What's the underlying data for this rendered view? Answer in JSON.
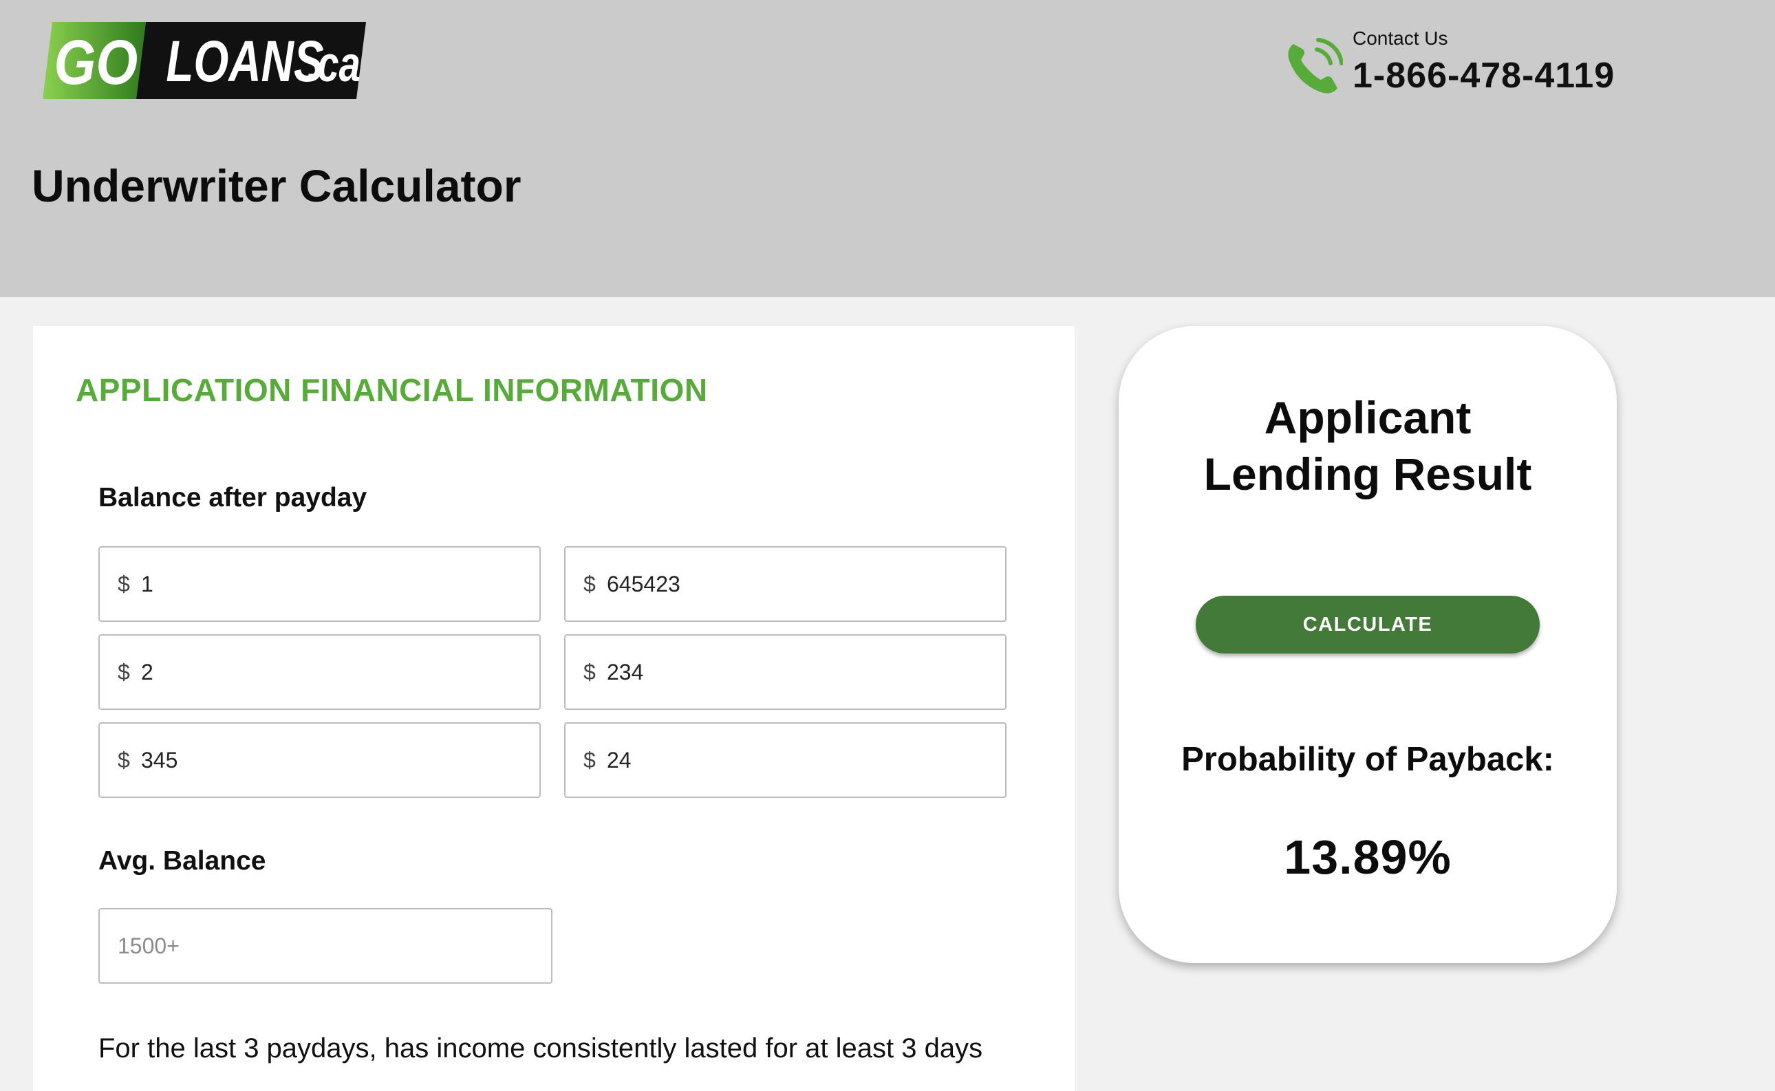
{
  "header": {
    "logo": {
      "part1": "GO",
      "part2": "LOANS",
      "suffix": ".ca"
    },
    "contact_label": "Contact Us",
    "contact_phone": "1-866-478-4119",
    "page_title": "Underwriter Calculator"
  },
  "form": {
    "section_title": "APPLICATION FINANCIAL INFORMATION",
    "balance_label": "Balance after payday",
    "currency_symbol": "$",
    "balances": [
      "1",
      "645423",
      "2",
      "234",
      "345",
      "24"
    ],
    "avg_label": "Avg. Balance",
    "avg_placeholder": "1500+",
    "avg_value": "",
    "question": "For the last 3 paydays, has income consistently lasted for at least 3 days"
  },
  "result": {
    "title_line1": "Applicant",
    "title_line2": "Lending Result",
    "calculate_label": "CALCULATE",
    "probability_label": "Probability of Payback:",
    "probability_value": "13.89%"
  },
  "colors": {
    "brand_green": "#57ab38",
    "button_green": "#437a39",
    "header_gray": "#cbcbcb"
  },
  "icons": [
    "phone-icon"
  ]
}
